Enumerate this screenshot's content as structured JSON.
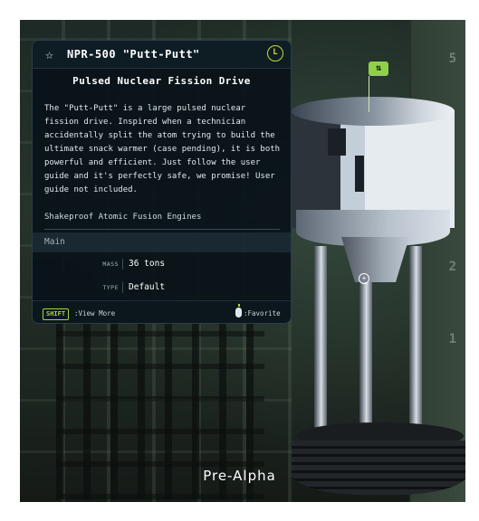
{
  "tooltip": {
    "title": "NPR-500 \"Putt-Putt\"",
    "badge": "L",
    "subtitle": "Pulsed Nuclear Fission Drive",
    "description": "The \"Putt-Putt\" is a large pulsed nuclear fission drive. Inspired when a technician accidentally split the atom trying to build the ultimate snack warmer (case pending), it is both powerful and efficient. Just follow the user guide and it's perfectly safe, we promise! User guide not included.",
    "manufacturer": "Shakeproof Atomic Fusion Engines",
    "group": "Main",
    "stats": [
      {
        "key": "MASS",
        "value": "36 tons"
      },
      {
        "key": "TYPE",
        "value": "Default"
      }
    ],
    "footer": {
      "shift_key": "SHIFT",
      "view_more": ":View More",
      "favorite": ":Favorite"
    },
    "icons": {
      "favorite": "star-outline-icon",
      "click": "mouse-icon"
    }
  },
  "scene": {
    "build_label": "Pre-Alpha",
    "wall_numbers": [
      "5",
      "2",
      "1"
    ]
  },
  "colors": {
    "accent_green": "#a9d63a",
    "badge_yellow": "#c8dc3a",
    "panel_bg": "#091218"
  }
}
